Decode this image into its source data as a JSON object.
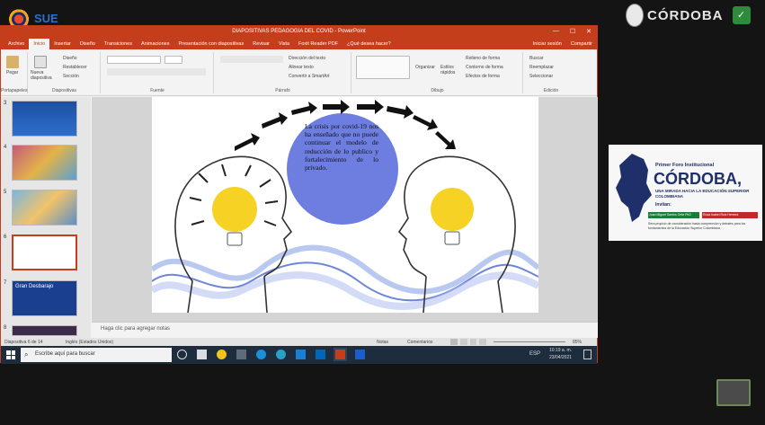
{
  "overlay": {
    "sue_logo_text": "SUE",
    "cordoba_logo_text": "CÓRDOBA"
  },
  "window": {
    "title": "DIAPOSITIVAS PEDAGOGIA DEL COVID - PowerPoint",
    "tabs": [
      "Archivo",
      "Inicio",
      "Insertar",
      "Diseño",
      "Transiciones",
      "Animaciones",
      "Presentación con diapositivas",
      "Revisar",
      "Vista",
      "Foxit Reader PDF",
      "¿Qué desea hacer?"
    ],
    "active_tab": "Inicio",
    "right_links": [
      "Iniciar sesión",
      "Compartir"
    ]
  },
  "ribbon": {
    "groups": [
      {
        "label": "Portapapeles",
        "items": [
          "Pegar"
        ]
      },
      {
        "label": "Diapositivas",
        "items": [
          "Nueva diapositiva",
          "Diseño",
          "Restablecer",
          "Sección"
        ]
      },
      {
        "label": "Fuente",
        "items": []
      },
      {
        "label": "Párrafo",
        "items": [
          "Dirección del texto",
          "Alinear texto",
          "Convertir a SmartArt"
        ]
      },
      {
        "label": "Dibujo",
        "items": [
          "Organizar",
          "Estilos rápidos",
          "Relleno de forma",
          "Contorno de forma",
          "Efectos de forma"
        ]
      },
      {
        "label": "Edición",
        "items": [
          "Buscar",
          "Reemplazar",
          "Seleccionar"
        ]
      }
    ]
  },
  "thumbnails": [
    {
      "num": "3",
      "title": "..."
    },
    {
      "num": "4",
      "title": ""
    },
    {
      "num": "5",
      "title": ""
    },
    {
      "num": "6",
      "title": ""
    },
    {
      "num": "7",
      "title": "Gran Desbarajo"
    },
    {
      "num": "8",
      "title": ""
    }
  ],
  "slide": {
    "text": "La crisis por covid-19 nos ha enseñado que no puede continuar el modelo de reducción de lo publico y fortalecimiento de lo privado."
  },
  "notes": {
    "placeholder": "Haga clic para agregar notas"
  },
  "status": {
    "slide_count": "Diapositiva 6 de 14",
    "language": "Inglés (Estados Unidos)",
    "notes": "Notas",
    "comments": "Comentarios",
    "zoom": "85%"
  },
  "taskbar": {
    "search_placeholder": "Escribe aquí para buscar",
    "lang": "ESP",
    "time": "10:19 a. m.",
    "date": "23/04/2021"
  },
  "panel": {
    "forum_title": "Primer Foro Institucional",
    "forum_name": "CÓRDOBA,",
    "subtitle": "UNA MIRADA HACIA LA EDUCACIÓN SUPERIOR COLOMBIANA",
    "invite": "Invitan:",
    "names": [
      "Juan Miguel Santos Ortiz PhD",
      "Rosa Isabel Ruiz Herrera"
    ],
    "footer": "Sera propicio de consideración hasta comprensión y debates para los fundamentos de la Educación Superior Colombiana."
  }
}
